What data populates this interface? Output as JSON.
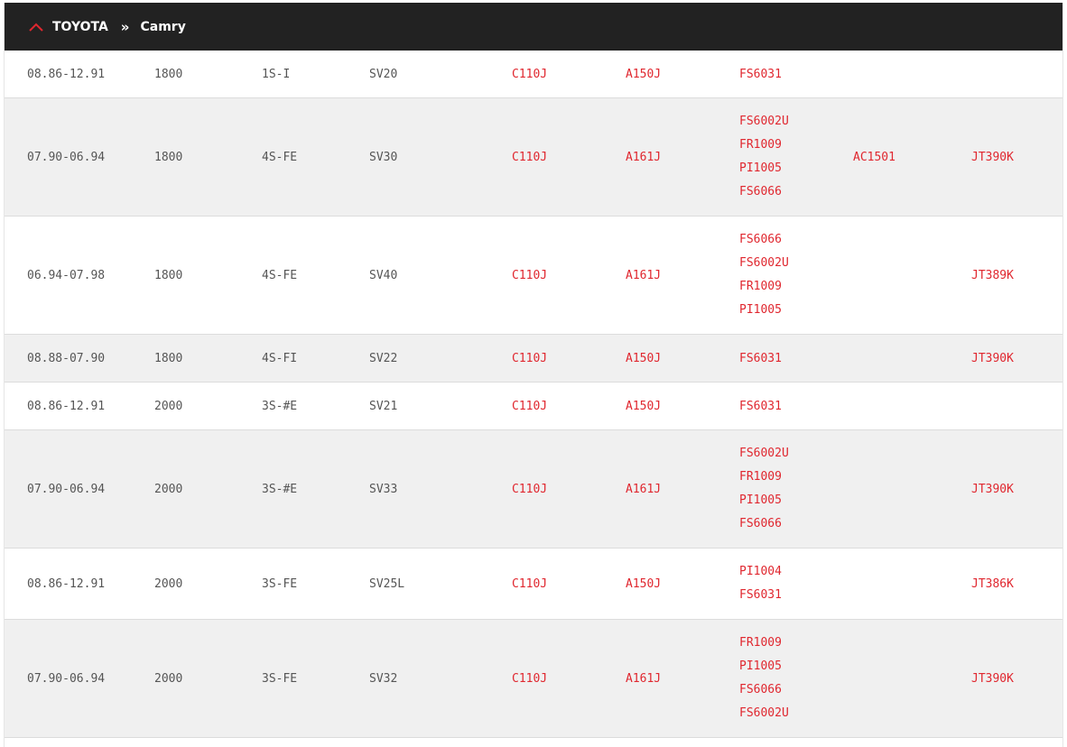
{
  "header": {
    "make": "TOYOTA",
    "separator": "»",
    "model": "Camry",
    "accent_color": "#e0272f"
  },
  "rows": [
    {
      "date": "08.86-12.91",
      "cc": "1800",
      "engine": "1S-I",
      "model": "SV20",
      "p1": "C110J",
      "p2": "A150J",
      "p3": [
        "FS6031"
      ],
      "p4": "",
      "p5": ""
    },
    {
      "date": "07.90-06.94",
      "cc": "1800",
      "engine": "4S-FE",
      "model": "SV30",
      "p1": "C110J",
      "p2": "A161J",
      "p3": [
        "FS6002U",
        "FR1009",
        "PI1005",
        "FS6066"
      ],
      "p4": "AC1501",
      "p5": "JT390K"
    },
    {
      "date": "06.94-07.98",
      "cc": "1800",
      "engine": "4S-FE",
      "model": "SV40",
      "p1": "C110J",
      "p2": "A161J",
      "p3": [
        "FS6066",
        "FS6002U",
        "FR1009",
        "PI1005"
      ],
      "p4": "",
      "p5": "JT389K"
    },
    {
      "date": "08.88-07.90",
      "cc": "1800",
      "engine": "4S-FI",
      "model": "SV22",
      "p1": "C110J",
      "p2": "A150J",
      "p3": [
        "FS6031"
      ],
      "p4": "",
      "p5": "JT390K"
    },
    {
      "date": "08.86-12.91",
      "cc": "2000",
      "engine": "3S-#E",
      "model": "SV21",
      "p1": "C110J",
      "p2": "A150J",
      "p3": [
        "FS6031"
      ],
      "p4": "",
      "p5": ""
    },
    {
      "date": "07.90-06.94",
      "cc": "2000",
      "engine": "3S-#E",
      "model": "SV33",
      "p1": "C110J",
      "p2": "A161J",
      "p3": [
        "FS6002U",
        "FR1009",
        "PI1005",
        "FS6066"
      ],
      "p4": "",
      "p5": "JT390K"
    },
    {
      "date": "08.86-12.91",
      "cc": "2000",
      "engine": "3S-FE",
      "model": "SV25L",
      "p1": "C110J",
      "p2": "A150J",
      "p3": [
        "PI1004",
        "FS6031"
      ],
      "p4": "",
      "p5": "JT386K"
    },
    {
      "date": "07.90-06.94",
      "cc": "2000",
      "engine": "3S-FE",
      "model": "SV32",
      "p1": "C110J",
      "p2": "A161J",
      "p3": [
        "FR1009",
        "PI1005",
        "FS6066",
        "FS6002U"
      ],
      "p4": "",
      "p5": "JT390K"
    }
  ]
}
